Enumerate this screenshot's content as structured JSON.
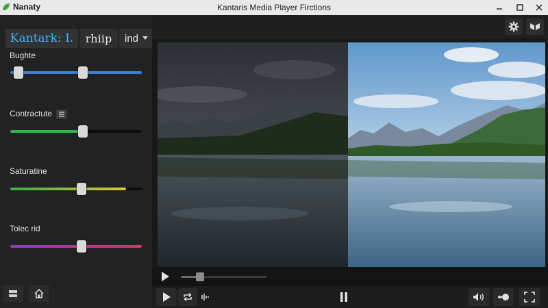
{
  "app": {
    "name": "Nanaty",
    "window_title": "Kantaris Media Player Firctions"
  },
  "sidebar": {
    "tabs": [
      {
        "label": "Kantark: I."
      },
      {
        "label": "rhiip"
      },
      {
        "label": "ind"
      }
    ],
    "controls": [
      {
        "label": "Bughte",
        "value": 0.55,
        "thumbs": [
          0.06,
          0.55
        ]
      },
      {
        "label": "Contractute",
        "value": 0.55
      },
      {
        "label": "Saturatine",
        "value": 0.54
      },
      {
        "label": "Tolec rid",
        "value": 0.54
      }
    ]
  },
  "player": {
    "progress": 0.22
  },
  "colors": {
    "accent": "#3fb0ff",
    "brightness_track": "#3d7fd0",
    "contrast_track": "#3fae4a",
    "saturation_track_start": "#33b04a",
    "saturation_track_end": "#e2c43a",
    "tint_track_start": "#8a3fc8",
    "tint_track_end": "#e0306a"
  },
  "icons": {
    "app": "leaf-icon",
    "settings": "gear-icon",
    "compare": "split-view-icon",
    "playlist": "list-icon",
    "home": "home-icon",
    "play": "play-icon",
    "pause": "pause-icon",
    "loop": "loop-icon",
    "audio_track": "audio-track-icon",
    "volume": "volume-icon",
    "record": "record-icon",
    "fullscreen": "fullscreen-icon"
  }
}
